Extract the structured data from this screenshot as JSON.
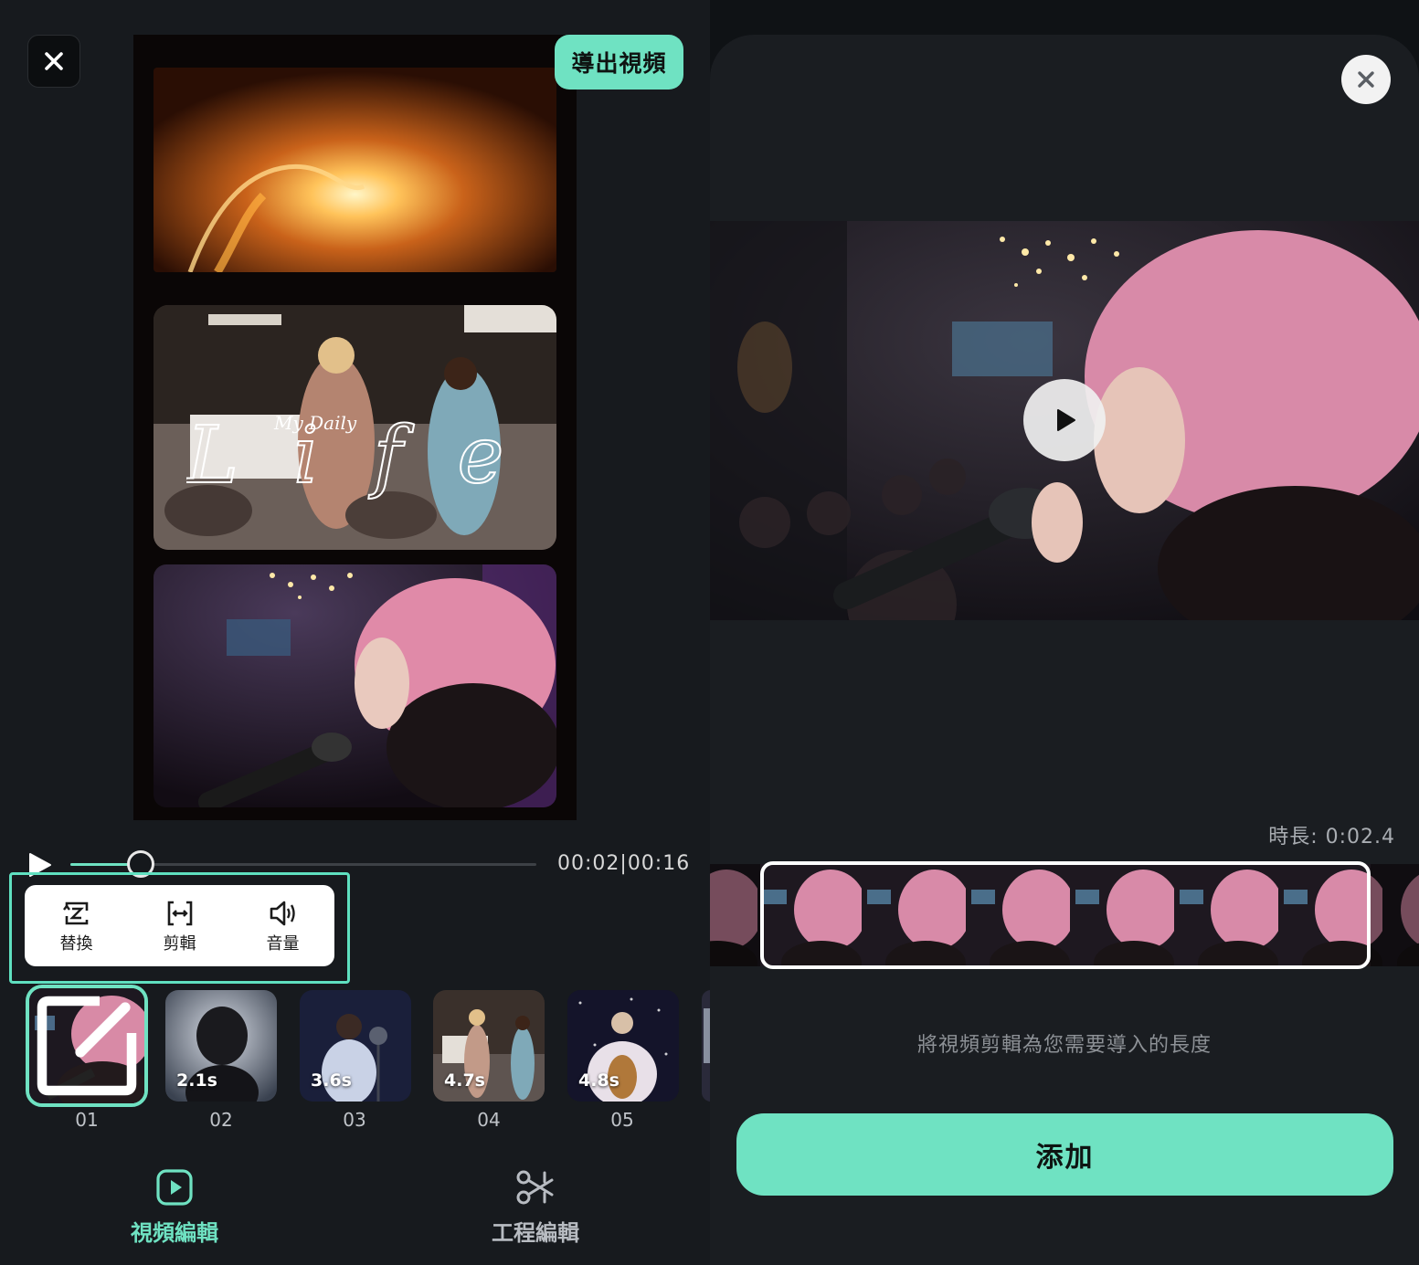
{
  "header": {
    "close_icon": "close-icon",
    "export_label": "導出視頻"
  },
  "preview": {
    "overlay_text_small": "My Daily",
    "overlay_text_script": "Life"
  },
  "playback": {
    "play_icon": "play-icon",
    "progress_percent": 15,
    "time_readout": "00:02|00:16"
  },
  "tools": [
    {
      "icon": "replace-icon",
      "label": "替換"
    },
    {
      "icon": "trim-icon",
      "label": "剪輯"
    },
    {
      "icon": "volume-icon",
      "label": "音量"
    }
  ],
  "clips": [
    {
      "number": "01",
      "duration": "",
      "selected": true
    },
    {
      "number": "02",
      "duration": "2.1s"
    },
    {
      "number": "03",
      "duration": "3.6s"
    },
    {
      "number": "04",
      "duration": "4.7s"
    },
    {
      "number": "05",
      "duration": "4.8s"
    }
  ],
  "bottom_nav": [
    {
      "icon": "video-edit-icon",
      "label": "視頻編輯",
      "active": true
    },
    {
      "icon": "project-edit-icon",
      "label": "工程編輯",
      "active": false
    }
  ],
  "trim_sheet": {
    "close_icon": "close-icon",
    "play_icon": "play-icon",
    "duration_text": "時長: 0:02.4",
    "hint": "將視頻剪輯為您需要導入的長度",
    "add_label": "添加"
  },
  "colors": {
    "accent": "#6fe2c2",
    "background": "#171a1e",
    "sheet": "#1a1d21"
  }
}
